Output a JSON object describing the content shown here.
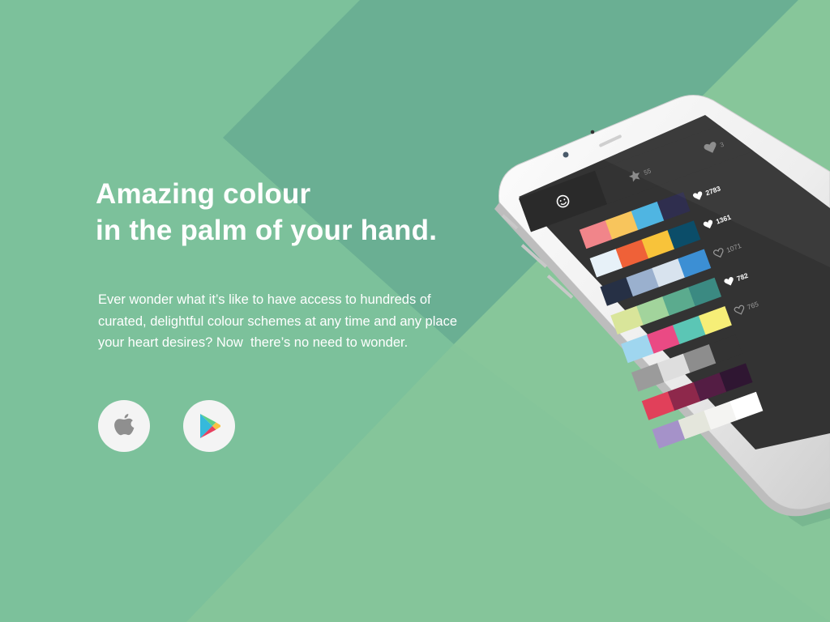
{
  "hero": {
    "title_line1": "Amazing colour",
    "title_line2": "in the palm of your hand.",
    "body_line1": "Ever wonder what it’s like to have access to hundreds of",
    "body_line2": "curated, delightful colour schemes at any time and any place",
    "body_line3": "your heart desires? Now  there’s no need to wonder."
  },
  "store_buttons": [
    {
      "name": "app-store-button",
      "icon": "apple-icon"
    },
    {
      "name": "google-play-button",
      "icon": "google-play-icon"
    }
  ],
  "theme": {
    "background": "#7cc19b",
    "band_dark": "#6aaf93",
    "band_light": "#8ac79a",
    "button_bg": "#f4f4f4",
    "phone_screen": "#333333"
  },
  "phone": {
    "tabs": [
      {
        "icon": "smiley-icon",
        "label": "",
        "active": true
      },
      {
        "icon": "star-icon",
        "label": "55",
        "active": false
      },
      {
        "icon": "heart-icon",
        "label": "3",
        "active": false
      }
    ],
    "palettes": [
      {
        "likes": "2783",
        "liked": true,
        "colors": [
          "#f1858a",
          "#f8c55c",
          "#4fb5e2",
          "#2f2e4e"
        ]
      },
      {
        "likes": "1361",
        "liked": true,
        "colors": [
          "#e7f1f8",
          "#ef6138",
          "#f8c33a",
          "#0b4d69"
        ]
      },
      {
        "likes": "1071",
        "liked": false,
        "colors": [
          "#263045",
          "#9ab0ce",
          "#d8e3ee",
          "#3c8fd4"
        ]
      },
      {
        "likes": "782",
        "liked": true,
        "colors": [
          "#d9e59a",
          "#a2d49c",
          "#5bab8e",
          "#3b8a82"
        ]
      },
      {
        "likes": "765",
        "liked": false,
        "colors": [
          "#9fd6ef",
          "#ea4a84",
          "#5bc6b5",
          "#f6ee77"
        ]
      },
      {
        "likes": "",
        "liked": false,
        "colors": [
          "#9b9b9b",
          "#dedede",
          "#8d8d8d",
          "#333333"
        ]
      },
      {
        "likes": "",
        "liked": false,
        "colors": [
          "#e1405a",
          "#8e284b",
          "#541d44",
          "#2f1632"
        ]
      },
      {
        "likes": "",
        "liked": false,
        "colors": [
          "#a592c9",
          "#e4e6dc",
          "#f4f4f2",
          "#ffffff"
        ]
      }
    ]
  }
}
